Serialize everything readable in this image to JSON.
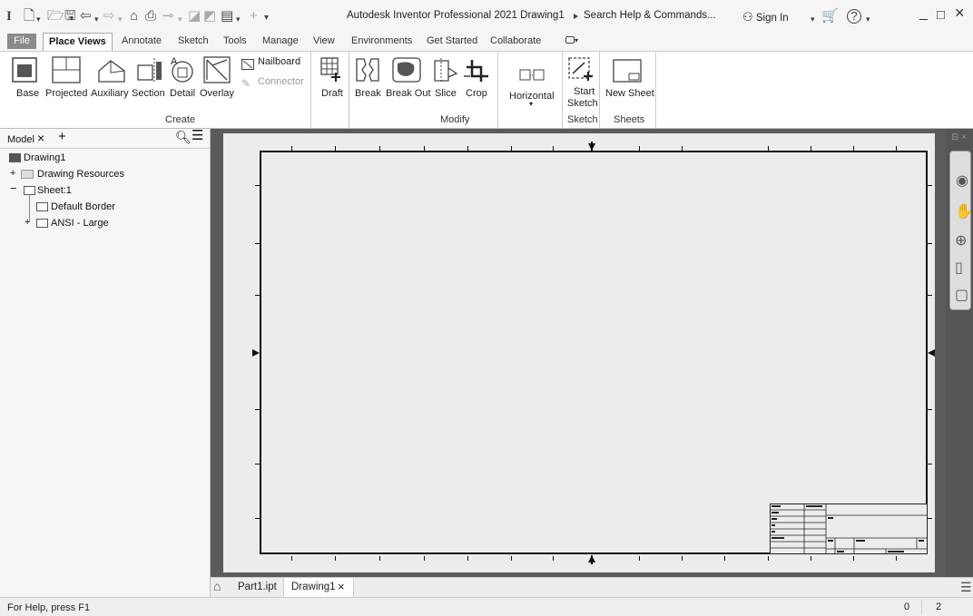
{
  "titlebar": {
    "app_title": "Autodesk Inventor Professional 2021   Drawing1",
    "search_label": "Search Help & Commands...",
    "sign_in": "Sign In",
    "help_icon": "?",
    "minimize": "_",
    "restore": "□",
    "close": "×"
  },
  "tabs": {
    "file": "File",
    "place_views": "Place Views",
    "annotate": "Annotate",
    "sketch": "Sketch",
    "tools": "Tools",
    "manage": "Manage",
    "view": "View",
    "environments": "Environments",
    "get_started": "Get Started",
    "collaborate": "Collaborate"
  },
  "ribbon": {
    "base": "Base",
    "projected": "Projected",
    "auxiliary": "Auxiliary",
    "section": "Section",
    "detail": "Detail",
    "overlay": "Overlay",
    "nailboard": "Nailboard",
    "connector": "Connector",
    "draft": "Draft",
    "break": "Break",
    "break_out": "Break Out",
    "slice": "Slice",
    "crop": "Crop",
    "horizontal": "Horizontal",
    "start_sketch_1": "Start",
    "start_sketch_2": "Sketch",
    "new_sheet": "New Sheet",
    "group_create": "Create",
    "group_modify": "Modify",
    "group_sketch": "Sketch",
    "group_sheets": "Sheets"
  },
  "browser": {
    "title": "Model",
    "close": "×",
    "add": "+",
    "items": {
      "drawing1": "Drawing1",
      "drawing_resources": "Drawing Resources",
      "sheet1": "Sheet:1",
      "default_border": "Default Border",
      "ansi_large": "ANSI - Large"
    }
  },
  "doc_tabs": {
    "part1": "Part1.ipt",
    "drawing1": "Drawing1",
    "close": "×"
  },
  "status": {
    "help": "For Help, press F1",
    "count1": "0",
    "count2": "2"
  },
  "colors": {
    "canvas": "#5b5b5b",
    "sheet": "#ececec",
    "file_tab": "#8a8a8a"
  }
}
